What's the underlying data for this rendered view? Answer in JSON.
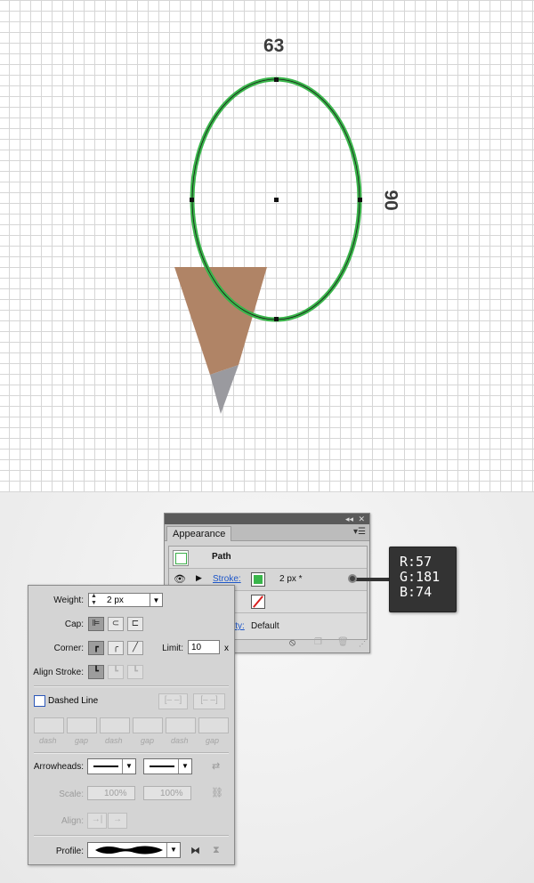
{
  "canvas": {
    "width_label": "63",
    "height_label": "90",
    "ellipse_stroke_color": "#39b54a",
    "cone_color": "#b08466",
    "tip_color": "#9a9a9f"
  },
  "appearance": {
    "tab": "Appearance",
    "collapse_icon": "double-chevron-icon",
    "close_label": "✕",
    "menu_icon": "panel-menu-icon",
    "path_label": "Path",
    "stroke_link": "Stroke:",
    "stroke_value": "2 px *",
    "stroke_color": "#39b54a",
    "opacity_link": "ity:",
    "opacity_value": "Default",
    "footer_icons": [
      "clear-icon",
      "duplicate-icon",
      "delete-icon"
    ]
  },
  "tooltip": {
    "r": "R:57",
    "g": "G:181",
    "b": "B:74"
  },
  "stroke_panel": {
    "weight_label": "Weight:",
    "weight_value": "2 px",
    "cap_label": "Cap:",
    "corner_label": "Corner:",
    "limit_label": "Limit:",
    "limit_value": "10",
    "limit_unit": "x",
    "align_label": "Align Stroke:",
    "dashed_label": "Dashed Line",
    "dash_labels": [
      "dash",
      "gap",
      "dash",
      "gap",
      "dash",
      "gap"
    ],
    "arrowheads_label": "Arrowheads:",
    "scale_label": "Scale:",
    "scale_start": "100%",
    "scale_end": "100%",
    "align_arrow_label": "Align:",
    "profile_label": "Profile:"
  }
}
